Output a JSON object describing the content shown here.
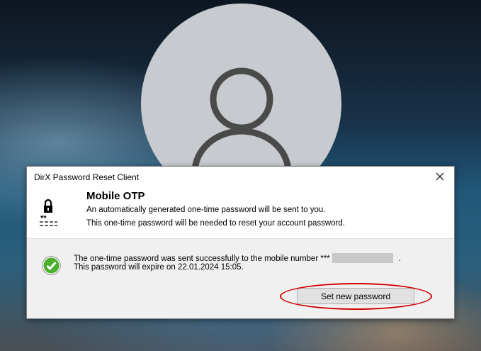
{
  "dialog": {
    "title": "DirX Password Reset Client",
    "heading": "Mobile OTP",
    "line1": "An automatically generated one-time password will be sent to you.",
    "line2": "This one-time password will be needed to reset your account password.",
    "message_line1_prefix": "The one-time password was sent successfully to the mobile number ***",
    "message_line1_suffix": ".",
    "message_line2": "This password will expire on 22.01.2024 15:05.",
    "button_label": "Set new password"
  },
  "icons": {
    "close": "close-icon",
    "lock": "lock-password-icon",
    "success": "success-check-icon",
    "avatar": "user-avatar-icon"
  },
  "colors": {
    "highlight": "#d00000",
    "success": "#4caf2d"
  }
}
